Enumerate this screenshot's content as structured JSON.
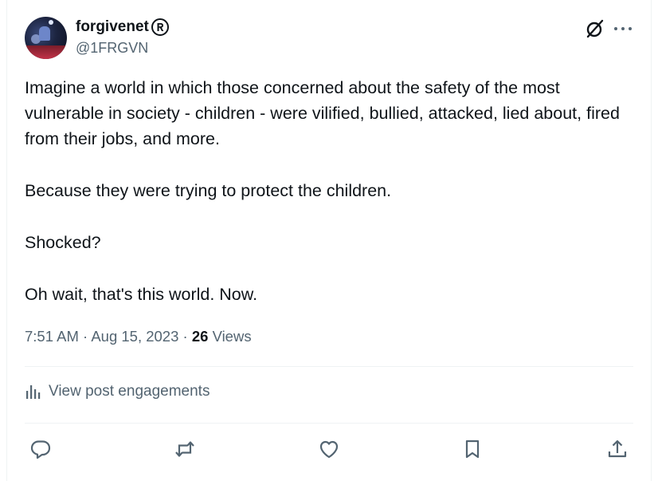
{
  "author": {
    "display_name": "forgivenet",
    "handle": "@1FRGVN"
  },
  "post": {
    "paragraphs": [
      "Imagine a world in which those concerned about the safety of the most vulnerable in society - children - were vilified, bullied, attacked, lied about, fired from their jobs, and more.",
      "Because they were trying to protect the children.",
      "Shocked?",
      "Oh wait, that's this world. Now."
    ],
    "time": "7:51 AM",
    "separator": " · ",
    "date": "Aug 15, 2023",
    "views_count": "26",
    "views_label": "Views"
  },
  "engagements": {
    "label": "View post engagements"
  },
  "colors": {
    "text_primary": "#0f1419",
    "text_secondary": "#536471",
    "divider": "#eff3f4",
    "icon": "#536471"
  },
  "icons": {
    "grok": "grok-slash-circle-icon",
    "more": "more-dots-icon",
    "registered": "registered-mark-icon",
    "analytics": "bar-chart-icon",
    "reply": "reply-bubble-icon",
    "repost": "repost-arrows-icon",
    "like": "heart-icon",
    "bookmark": "bookmark-icon",
    "share": "share-upload-icon"
  }
}
